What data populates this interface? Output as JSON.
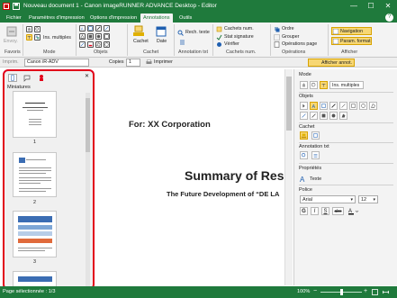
{
  "window": {
    "title": "Nouveau document 1 - Canon imageRUNNER ADVANCE Desktop - Editor",
    "minimize": "—",
    "maximize": "☐",
    "close": "✕"
  },
  "menu": {
    "tabs": [
      {
        "label": "Fichier",
        "active": false
      },
      {
        "label": "Paramètres d'impression",
        "active": false
      },
      {
        "label": "Options d'impression",
        "active": false
      },
      {
        "label": "Annotations",
        "active": true
      },
      {
        "label": "Outils",
        "active": false
      }
    ],
    "help": "?"
  },
  "ribbon": {
    "favoris": {
      "button": "Envoy.",
      "label": "Favoris"
    },
    "mode": {
      "label": "Mode",
      "multi": "Ins. multiples"
    },
    "objets": {
      "label": "Objets"
    },
    "cachet": {
      "button": "Cachet",
      "label": "Cachet"
    },
    "date": {
      "button": "Date",
      "label": "Cachet"
    },
    "annot_txt": {
      "rech": "Rech. texte",
      "label": "Annotation txt"
    },
    "cachets_num": {
      "item1": "Cachets num.",
      "item2": "Stat signature",
      "item3": "Vérifier",
      "label": "Cachets num."
    },
    "operations": {
      "ordre": "Ordre",
      "grouper": "Grouper",
      "ops_page": "Opérations page",
      "label": "Opérations"
    },
    "afficher": {
      "navigation": "Navigation",
      "param_format": "Param. format",
      "label": "Afficher"
    }
  },
  "printbar": {
    "imprim_label": "Imprim.",
    "printer": "Canon iR-ADV",
    "copies_label": "Copies",
    "copies": "1",
    "print_button": "Imprimer",
    "show_annot": "Afficher annot."
  },
  "left_panel": {
    "title": "Miniatures",
    "close": "✕",
    "thumbnails": [
      {
        "page": "1"
      },
      {
        "page": "2"
      },
      {
        "page": "3"
      }
    ]
  },
  "document": {
    "for_line": "For: XX Corporation",
    "heading": "Summary of Res",
    "subheading": "The Future Development of “DE LA"
  },
  "right_panel": {
    "mode_label": "Mode",
    "multi": "Ins. multiples",
    "objets_label": "Objets",
    "cachet_label": "Cachet",
    "annot_label": "Annotation txt",
    "props_label": "Propriétés",
    "texte_label": "Texte",
    "police_label": "Police",
    "font": "Arial",
    "size": "12",
    "bold": "G",
    "italic": "I",
    "underline": "S",
    "strike": "abc"
  },
  "status": {
    "selection": "Page sélectionnée : 1/3",
    "zoom": "100%"
  },
  "colors": {
    "brand_green": "#1f7a3c",
    "highlight_red": "#e2001a",
    "accent_yellow": "#f7d774"
  }
}
